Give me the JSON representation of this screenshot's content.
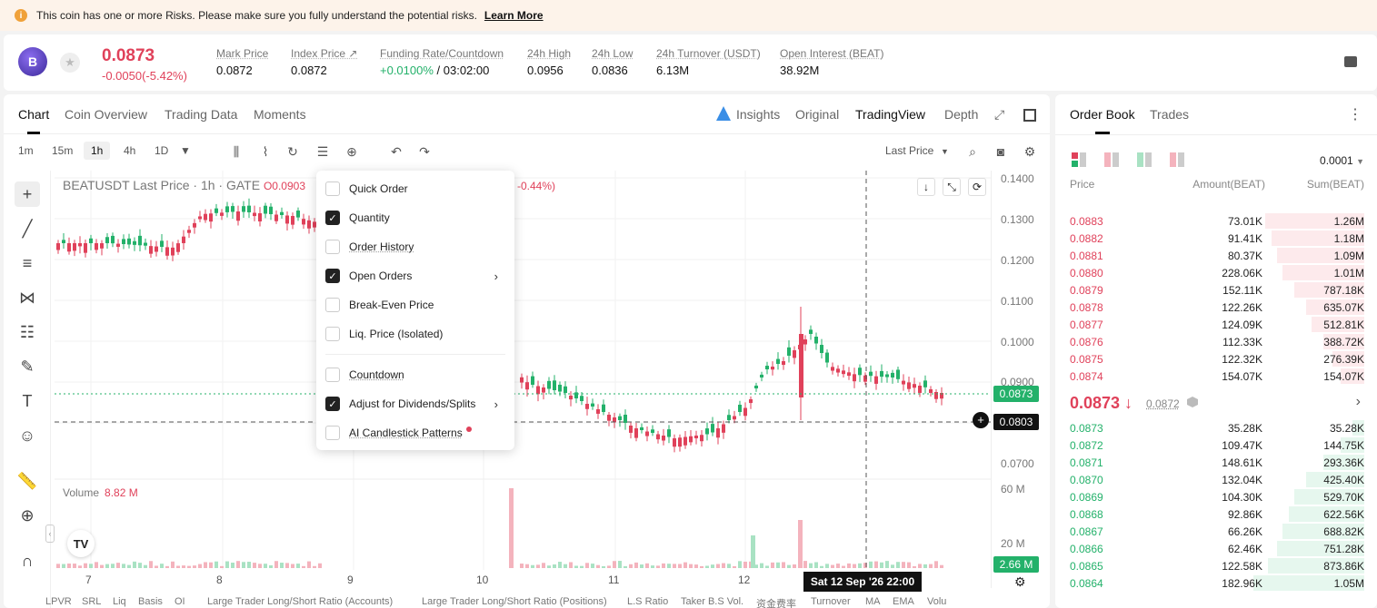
{
  "risk": {
    "text": "This coin has one or more Risks. Please make sure you fully understand the potential risks.",
    "link": "Learn More"
  },
  "ticker": {
    "price": "0.0873",
    "change": "-0.0050(-5.42%)",
    "stats": [
      {
        "label": "Mark Price",
        "value": "0.0872"
      },
      {
        "label": "Index Price ↗",
        "value": "0.0872"
      },
      {
        "label": "Funding Rate/Countdown",
        "value_green": "+0.0100%",
        "value": " / 03:02:00"
      },
      {
        "label": "24h High",
        "value": "0.0956"
      },
      {
        "label": "24h Low",
        "value": "0.0836"
      },
      {
        "label": "24h Turnover (USDT)",
        "value": "6.13M"
      },
      {
        "label": "Open Interest (BEAT)",
        "value": "38.92M"
      }
    ]
  },
  "chart_tabs": [
    "Chart",
    "Coin Overview",
    "Trading Data",
    "Moments"
  ],
  "view_tabs": [
    "Insights",
    "Original",
    "TradingView",
    "Depth"
  ],
  "timeframes": [
    "1m",
    "15m",
    "1h",
    "4h",
    "1D"
  ],
  "price_type": "Last Price",
  "chart_title": "BEATUSDT Last Price · 1h · GATE",
  "chart_ohlc_left": "O0.0903",
  "chart_ohlc_right": "-0.44%)",
  "volume_label": "Volume",
  "volume_value": "8.82 M",
  "y_ticks": [
    "0.1400",
    "0.1300",
    "0.1200",
    "0.1100",
    "0.1000",
    "0.0900",
    "0.0700"
  ],
  "vol_ticks": [
    "60 M",
    "20 M"
  ],
  "last_price_label": "0.0873",
  "cross_price_label": "0.0803",
  "vol_label": "2.66 M",
  "x_ticks": [
    "7",
    "8",
    "9",
    "10",
    "11",
    "12"
  ],
  "cross_date": "Sat 12 Sep '26   22:00",
  "bottom_items": [
    "LPVR",
    "SRL",
    "Liq",
    "Basis",
    "OI",
    "Large Trader Long/Short Ratio (Accounts)",
    "Large Trader Long/Short Ratio (Positions)",
    "L.S Ratio",
    "Taker B.S Vol.",
    "资金费率",
    "Turnover",
    "MA",
    "EMA",
    "Volu"
  ],
  "dropdown": [
    {
      "label": "Quick Order",
      "checked": false
    },
    {
      "label": "Quantity",
      "checked": true
    },
    {
      "label": "Order History",
      "checked": false
    },
    {
      "label": "Open Orders",
      "checked": true,
      "submenu": true
    },
    {
      "label": "Break-Even Price",
      "checked": false
    },
    {
      "label": "Liq. Price (Isolated)",
      "checked": false
    },
    {
      "label": "Countdown",
      "checked": false
    },
    {
      "label": "Adjust for Dividends/Splits",
      "checked": true,
      "submenu": true
    },
    {
      "label": "AI Candlestick Patterns",
      "checked": false,
      "dot": true
    }
  ],
  "orderbook": {
    "tabs": [
      "Order Book",
      "Trades"
    ],
    "precision": "0.0001",
    "headers": [
      "Price",
      "Amount(BEAT)",
      "Sum(BEAT)"
    ],
    "asks": [
      [
        "0.0883",
        "73.01K",
        "1.26M",
        0.34
      ],
      [
        "0.0882",
        "91.41K",
        "1.18M",
        0.32
      ],
      [
        "0.0881",
        "80.37K",
        "1.09M",
        0.3
      ],
      [
        "0.0880",
        "228.06K",
        "1.01M",
        0.28
      ],
      [
        "0.0879",
        "152.11K",
        "787.18K",
        0.24
      ],
      [
        "0.0878",
        "122.26K",
        "635.07K",
        0.2
      ],
      [
        "0.0877",
        "124.09K",
        "512.81K",
        0.18
      ],
      [
        "0.0876",
        "112.33K",
        "388.72K",
        0.14
      ],
      [
        "0.0875",
        "122.32K",
        "276.39K",
        0.11
      ],
      [
        "0.0874",
        "154.07K",
        "154.07K",
        0.08
      ]
    ],
    "mid_price": "0.0873 ↓",
    "mid_mark": "0.0872",
    "bids": [
      [
        "0.0873",
        "35.28K",
        "35.28K",
        0.04
      ],
      [
        "0.0872",
        "109.47K",
        "144.75K",
        0.08
      ],
      [
        "0.0871",
        "148.61K",
        "293.36K",
        0.14
      ],
      [
        "0.0870",
        "132.04K",
        "425.40K",
        0.2
      ],
      [
        "0.0869",
        "104.30K",
        "529.70K",
        0.24
      ],
      [
        "0.0868",
        "92.86K",
        "622.56K",
        0.26
      ],
      [
        "0.0867",
        "66.26K",
        "688.82K",
        0.28
      ],
      [
        "0.0866",
        "62.46K",
        "751.28K",
        0.3
      ],
      [
        "0.0865",
        "122.58K",
        "873.86K",
        0.33
      ],
      [
        "0.0864",
        "182.96K",
        "1.05M",
        0.38
      ]
    ]
  },
  "colors": {
    "up": "#23b16a",
    "down": "#e0415a",
    "accent": "#111111"
  }
}
